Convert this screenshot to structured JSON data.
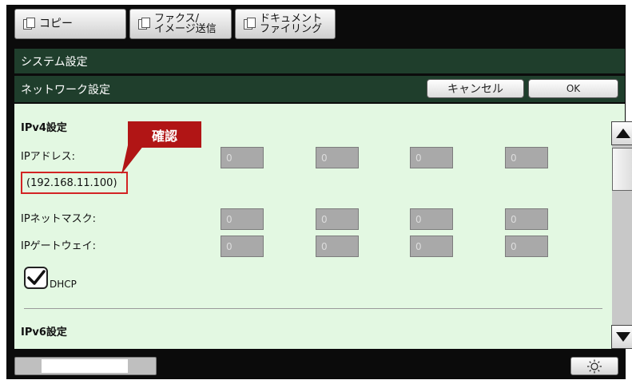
{
  "tabs": [
    {
      "label": "コピー"
    },
    {
      "line1": "ファクス/",
      "line2": "イメージ送信"
    },
    {
      "line1": "ドキュメント",
      "line2": "ファイリング"
    }
  ],
  "header": {
    "title": "システム設定",
    "subtitle": "ネットワーク設定",
    "cancel_label": "キャンセル",
    "ok_label": "OK"
  },
  "ipv4": {
    "section_title": "IPv4設定",
    "ip_address_label": "IPアドレス:",
    "ip_address_note": "(192.168.11.100)",
    "ip_fields": [
      "0",
      "0",
      "0",
      "0"
    ],
    "subnet_label": "IPネットマスク:",
    "subnet_fields": [
      "0",
      "0",
      "0",
      "0"
    ],
    "gateway_label": "IPゲートウェイ:",
    "gateway_fields": [
      "0",
      "0",
      "0",
      "0"
    ],
    "dhcp_label": "DHCP",
    "dhcp_checked": true
  },
  "ipv6": {
    "section_title": "IPv6設定"
  },
  "annotation": {
    "callout_label": "確認",
    "callout_color": "#b11515",
    "highlight_color": "#d32424"
  },
  "icons": {
    "tab_icon": "document-copy-icon",
    "scroll_up": "triangle-up-icon",
    "scroll_down": "triangle-down-icon",
    "brightness": "sun-icon",
    "dhcp": "checkmark-icon"
  },
  "colors": {
    "title_bar": "#1f3e2c",
    "panel": "#e3f8e2",
    "field": "#a9a9a9"
  }
}
